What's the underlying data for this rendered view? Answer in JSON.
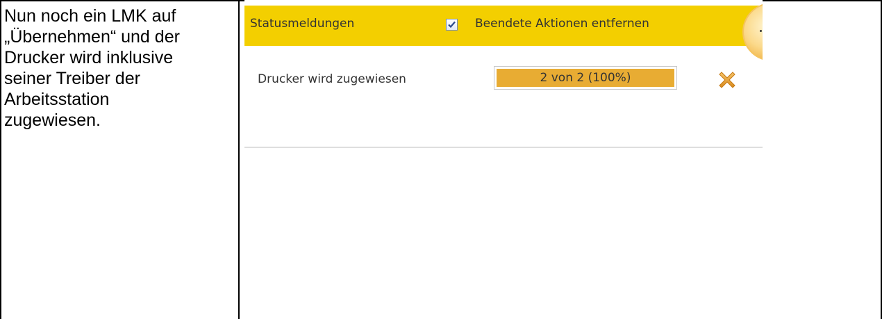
{
  "instruction": {
    "text": "Nun noch ein LMK auf\n„Übernehmen“ und der\nDrucker wird inklusive\nseiner Treiber der\nArbeitsstation\nzugewiesen."
  },
  "status_panel": {
    "title": "Statusmeldungen",
    "checkbox_checked": true,
    "checkbox_label": "Beendete Aktionen entfernen",
    "accent_color": "#f3cf00"
  },
  "action": {
    "label": "Drucker wird zugewiesen",
    "progress_text": "2 von 2 (100%)",
    "progress_fraction": 1.0,
    "progress_color": "#e8ac33",
    "cancel_icon": "cancel-x-icon"
  }
}
